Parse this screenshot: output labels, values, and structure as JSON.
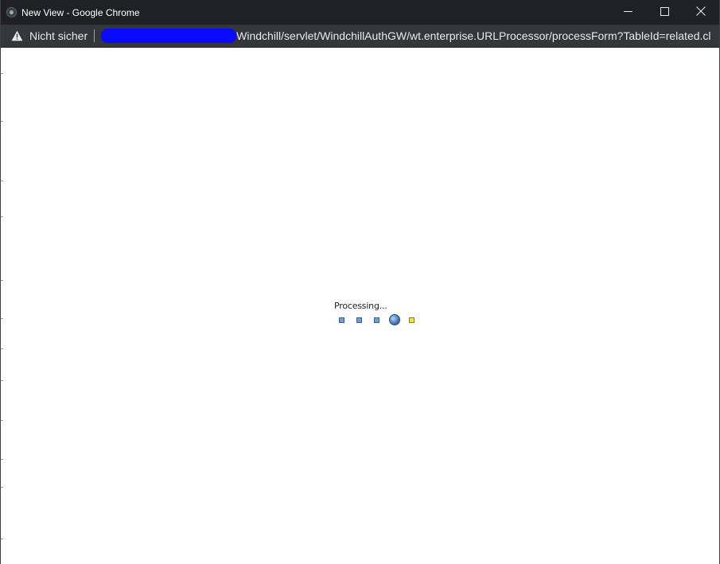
{
  "window": {
    "title": "New View - Google Chrome"
  },
  "addressbar": {
    "security_label": "Nicht sicher",
    "url": "Windchill/servlet/WindchillAuthGW/wt.enterprise.URLProcessor/processForm?TableId=related.cl"
  },
  "content": {
    "processing_label": "Processing..."
  },
  "icons": {
    "app": "chrome-app-icon",
    "warning": "warning-triangle-icon",
    "minimize": "minimize-icon",
    "maximize": "maximize-icon",
    "close": "close-icon"
  },
  "colors": {
    "titlebar": "#202124",
    "addressbar": "#35363a",
    "redaction": "#0a0aff",
    "loader_blue": "#6f9fd8",
    "loader_yellow": "#f5e04a"
  }
}
